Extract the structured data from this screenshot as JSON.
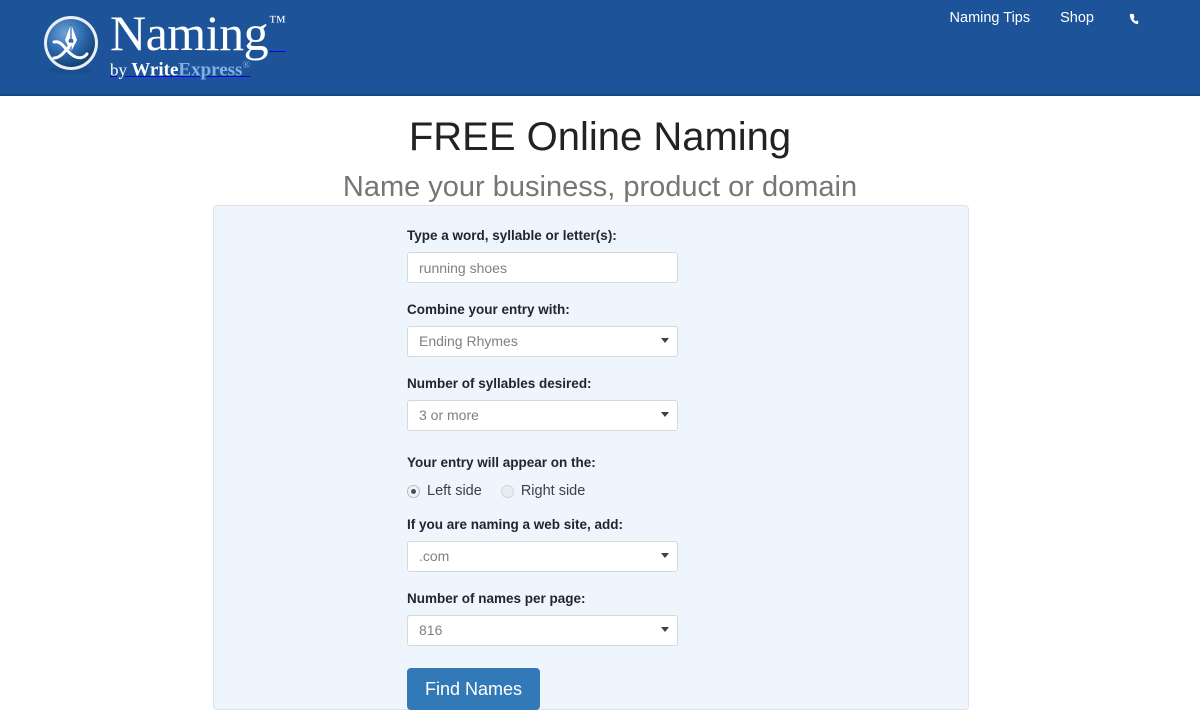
{
  "header": {
    "brand": {
      "name": "Naming",
      "tm": "™",
      "by": "by ",
      "write": "Write",
      "express": "Express",
      "reg": "®",
      "logo_icon": "pen-nib-circle-logo"
    },
    "nav": [
      {
        "label": "Naming Tips"
      },
      {
        "label": "Shop"
      }
    ],
    "phone_icon": "phone-icon",
    "bg_color": "#1d5499"
  },
  "page": {
    "title": "FREE Online Naming",
    "subtitle": "Name your business, product or domain"
  },
  "form": {
    "word_field": {
      "label": "Type a word, syllable or letter(s):",
      "value": "running shoes",
      "placeholder": "running shoes"
    },
    "combine_field": {
      "label": "Combine your entry with:",
      "value": "Ending Rhymes"
    },
    "syllables_field": {
      "label": "Number of syllables desired:",
      "value": "3 or more"
    },
    "side_field": {
      "label": "Your entry will appear on the:",
      "options": [
        {
          "label": "Left side",
          "selected": true
        },
        {
          "label": "Right side",
          "selected": false
        }
      ]
    },
    "domain_field": {
      "label": "If you are naming a web site, add:",
      "value": ".com"
    },
    "per_page_field": {
      "label": "Number of names per page:",
      "value": "816"
    },
    "submit_label": "Find Names",
    "panel_bg": "#eff5fc",
    "button_color": "#3279b7"
  }
}
